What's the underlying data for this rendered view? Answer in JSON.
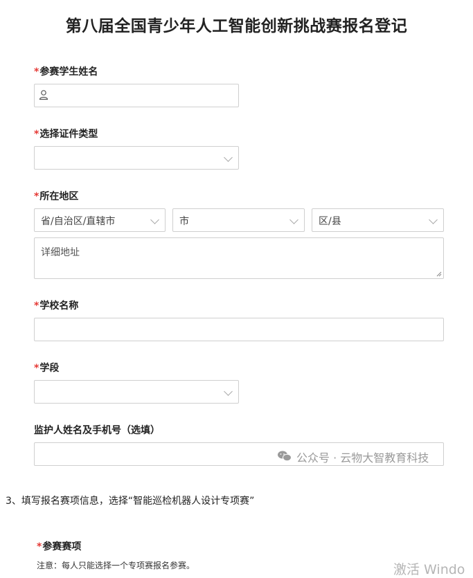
{
  "page": {
    "title": "第八届全国青少年人工智能创新挑战赛报名登记"
  },
  "form": {
    "student_name": {
      "label": "参赛学生姓名",
      "value": ""
    },
    "id_type": {
      "label": "选择证件类型",
      "selected": ""
    },
    "region": {
      "label": "所在地区",
      "province_placeholder": "省/自治区/直辖市",
      "city_placeholder": "市",
      "district_placeholder": "区/县",
      "address_placeholder": "详细地址"
    },
    "school": {
      "label": "学校名称",
      "value": ""
    },
    "grade": {
      "label": "学段",
      "selected": ""
    },
    "guardian": {
      "label": "监护人姓名及手机号（选填）",
      "value": ""
    },
    "required_mark": "*"
  },
  "watermark": {
    "text": "公众号 · 云物大智教育科技",
    "icon": "wechat-icon"
  },
  "step_text": "3、填写报名赛项信息，选择“智能巡检机器人设计专项赛”",
  "event_section": {
    "label": "参赛赛项",
    "note": "注意：每人只能选择一个专项赛报名参赛。"
  },
  "overlay": {
    "activate_windows": "激活 Windo"
  }
}
